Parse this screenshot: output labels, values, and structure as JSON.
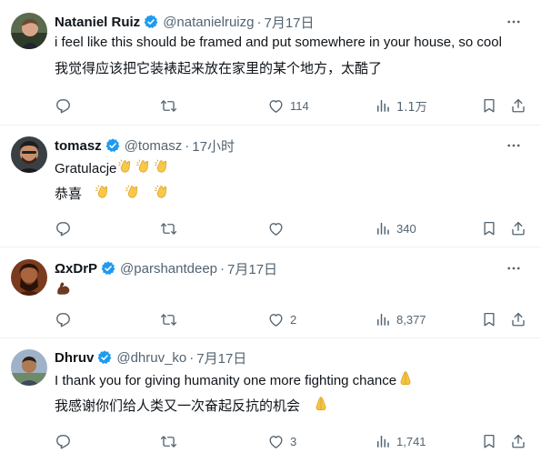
{
  "colors": {
    "text": "#0f1419",
    "secondary": "#536471",
    "verified_blue": "#1d9bf0",
    "divider": "#eff3f4",
    "clap_yellow": "#f7c948",
    "pray_yellow": "#f5c542",
    "arm_brown": "#6b3a25"
  },
  "tweets": [
    {
      "name": "Nataniel Ruiz",
      "handle": "@natanielruizg",
      "sep": "·",
      "time": "7月17日",
      "text": "i feel like this should be framed and put somewhere in your house, so cool",
      "translation": "我觉得应该把它装裱起来放在家里的某个地方，太酷了",
      "likes": "114",
      "views": "1.1万"
    },
    {
      "name": "tomasz",
      "handle": "@tomasz",
      "sep": "·",
      "time": "17小时",
      "text": "Gratulacje",
      "text_emoji": "clapping-hands-emoji x3",
      "translation": "恭喜",
      "translation_emoji": "clapping-hands-emoji x3",
      "views": "340"
    },
    {
      "name": "ΩxDrP",
      "handle": "@parshantdeep",
      "sep": "·",
      "time": "7月17日",
      "text_emoji": "flexed-biceps-emoji",
      "likes": "2",
      "views": "8,377"
    },
    {
      "name": "Dhruv",
      "handle": "@dhruv_ko",
      "sep": "·",
      "time": "7月17日",
      "text": "I thank you for giving humanity one more fighting chance",
      "text_emoji": "folded-hands-emoji",
      "translation": "我感谢你们给人类又一次奋起反抗的机会",
      "translation_emoji": "folded-hands-emoji",
      "likes": "3",
      "views": "1,741"
    }
  ],
  "icons": {
    "reply": "reply-icon",
    "retweet": "retweet-icon",
    "like": "heart-icon",
    "views": "views-icon",
    "bookmark": "bookmark-icon",
    "share": "share-icon",
    "more": "more-icon",
    "verified": "verified-badge-icon"
  }
}
